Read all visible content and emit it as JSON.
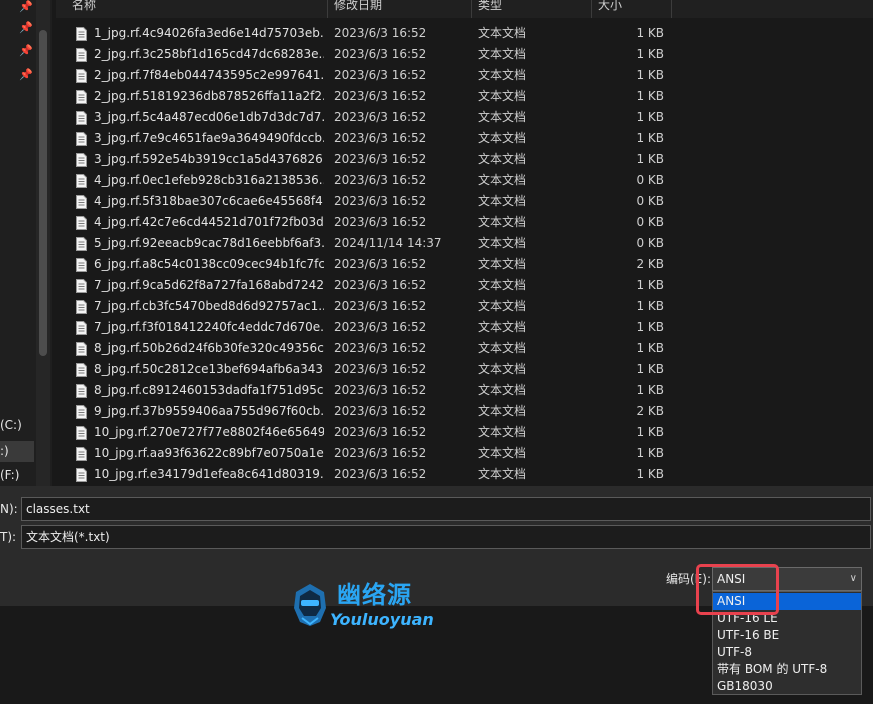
{
  "header": {
    "col_name": "名称",
    "col_date": "修改日期",
    "col_type": "类型",
    "col_size": "大小"
  },
  "nav": {
    "drives": [
      "(C:)",
      ":)",
      "(F:)"
    ]
  },
  "files": [
    {
      "name": "1_jpg.rf.4c94026fa3ed6e14d75703eb...",
      "date": "2023/6/3 16:52",
      "type": "文本文档",
      "size": "1 KB"
    },
    {
      "name": "2_jpg.rf.3c258bf1d165cd47dc68283e...",
      "date": "2023/6/3 16:52",
      "type": "文本文档",
      "size": "1 KB"
    },
    {
      "name": "2_jpg.rf.7f84eb044743595c2e997641...",
      "date": "2023/6/3 16:52",
      "type": "文本文档",
      "size": "1 KB"
    },
    {
      "name": "2_jpg.rf.51819236db878526ffa11a2f2...",
      "date": "2023/6/3 16:52",
      "type": "文本文档",
      "size": "1 KB"
    },
    {
      "name": "3_jpg.rf.5c4a487ecd06e1db7d3dc7d7...",
      "date": "2023/6/3 16:52",
      "type": "文本文档",
      "size": "1 KB"
    },
    {
      "name": "3_jpg.rf.7e9c4651fae9a3649490fdccb...",
      "date": "2023/6/3 16:52",
      "type": "文本文档",
      "size": "1 KB"
    },
    {
      "name": "3_jpg.rf.592e54b3919cc1a5d4376826...",
      "date": "2023/6/3 16:52",
      "type": "文本文档",
      "size": "1 KB"
    },
    {
      "name": "4_jpg.rf.0ec1efeb928cb316a2138536...",
      "date": "2023/6/3 16:52",
      "type": "文本文档",
      "size": "0 KB"
    },
    {
      "name": "4_jpg.rf.5f318bae307c6cae6e45568f4...",
      "date": "2023/6/3 16:52",
      "type": "文本文档",
      "size": "0 KB"
    },
    {
      "name": "4_jpg.rf.42c7e6cd44521d701f72fb03d...",
      "date": "2023/6/3 16:52",
      "type": "文本文档",
      "size": "0 KB"
    },
    {
      "name": "5_jpg.rf.92eeacb9cac78d16eebbf6af3...",
      "date": "2024/11/14 14:37",
      "type": "文本文档",
      "size": "0 KB"
    },
    {
      "name": "6_jpg.rf.a8c54c0138cc09cec94b1fc7fc...",
      "date": "2023/6/3 16:52",
      "type": "文本文档",
      "size": "2 KB"
    },
    {
      "name": "7_jpg.rf.9ca5d62f8a727fa168abd7242...",
      "date": "2023/6/3 16:52",
      "type": "文本文档",
      "size": "1 KB"
    },
    {
      "name": "7_jpg.rf.cb3fc5470bed8d6d92757ac1...",
      "date": "2023/6/3 16:52",
      "type": "文本文档",
      "size": "1 KB"
    },
    {
      "name": "7_jpg.rf.f3f018412240fc4eddc7d670e...",
      "date": "2023/6/3 16:52",
      "type": "文本文档",
      "size": "1 KB"
    },
    {
      "name": "8_jpg.rf.50b26d24f6b30fe320c49356c...",
      "date": "2023/6/3 16:52",
      "type": "文本文档",
      "size": "1 KB"
    },
    {
      "name": "8_jpg.rf.50c2812ce13bef694afb6a343...",
      "date": "2023/6/3 16:52",
      "type": "文本文档",
      "size": "1 KB"
    },
    {
      "name": "8_jpg.rf.c8912460153dadfa1f751d95c...",
      "date": "2023/6/3 16:52",
      "type": "文本文档",
      "size": "1 KB"
    },
    {
      "name": "9_jpg.rf.37b9559406aa755d967f60cb...",
      "date": "2023/6/3 16:52",
      "type": "文本文档",
      "size": "2 KB"
    },
    {
      "name": "10_jpg.rf.270e727f77e8802f46e65649...",
      "date": "2023/6/3 16:52",
      "type": "文本文档",
      "size": "1 KB"
    },
    {
      "name": "10_jpg.rf.aa93f63622c89bf7e0750a1e...",
      "date": "2023/6/3 16:52",
      "type": "文本文档",
      "size": "1 KB"
    },
    {
      "name": "10_jpg.rf.e34179d1efea8c641d80319...",
      "date": "2023/6/3 16:52",
      "type": "文本文档",
      "size": "1 KB"
    }
  ],
  "save": {
    "filename_label": "N):",
    "filename_value": "classes.txt",
    "filetype_label": "T):",
    "filetype_value": "文本文档(*.txt)",
    "encoding_label": "编码(E):",
    "encoding_value": "ANSI",
    "encoding_options": [
      "ANSI",
      "UTF-16 LE",
      "UTF-16 BE",
      "UTF-8",
      "带有 BOM 的 UTF-8",
      "GB18030"
    ],
    "encoding_selected_index": 0
  },
  "watermark": {
    "text": "幽络源",
    "subtext": "Youluoyuan"
  },
  "colors": {
    "selection": "#0a64d8",
    "highlight_box": "#e8424e",
    "watermark": "#2aa5f2"
  },
  "icons": {
    "file": "text-file-icon",
    "pin": "pin-icon",
    "chevron": "chevron-down-icon"
  }
}
